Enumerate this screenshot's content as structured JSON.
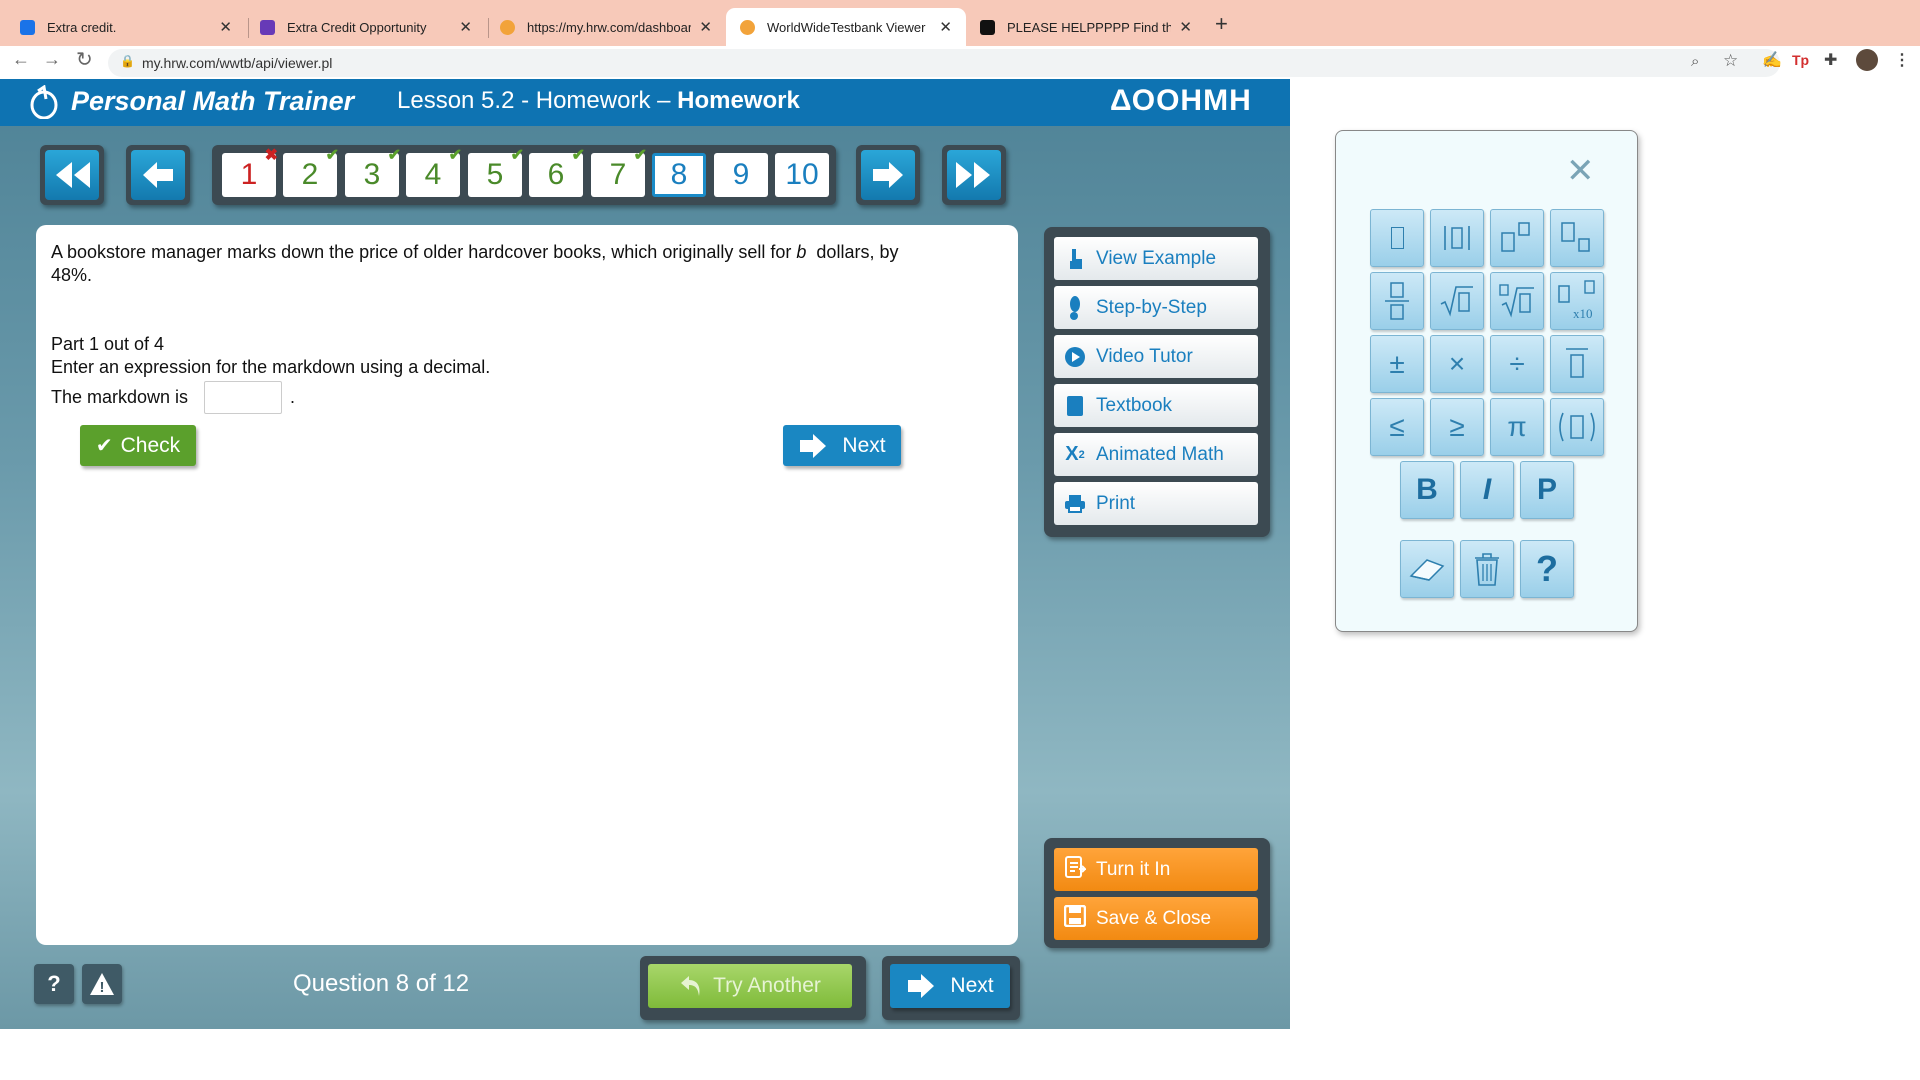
{
  "browser": {
    "tabs": [
      {
        "title": "Extra credit.",
        "favicon_color": "#1a73e8"
      },
      {
        "title": "Extra Credit Opportunity",
        "favicon_color": "#673ab7"
      },
      {
        "title": "https://my.hrw.com/dashboard",
        "favicon_color": "#f2a33a"
      },
      {
        "title": "WorldWideTestbank Viewer",
        "favicon_color": "#f2a33a",
        "active": true
      },
      {
        "title": "PLEASE HELPPPPP Find the sa",
        "favicon_color": "#111111"
      }
    ],
    "url": "my.hrw.com/wwtb/api/viewer.pl"
  },
  "header": {
    "brand": "Personal Math Trainer",
    "lesson_prefix": "Lesson 5.2 - Homework –",
    "lesson_suffix": "Homework",
    "publisher": "ΔΟΟHMH"
  },
  "questions": [
    {
      "num": "1",
      "status": "wrong"
    },
    {
      "num": "2",
      "status": "correct"
    },
    {
      "num": "3",
      "status": "correct"
    },
    {
      "num": "4",
      "status": "correct"
    },
    {
      "num": "5",
      "status": "correct"
    },
    {
      "num": "6",
      "status": "correct"
    },
    {
      "num": "7",
      "status": "correct"
    },
    {
      "num": "8",
      "status": "current"
    },
    {
      "num": "9",
      "status": "unanswered"
    },
    {
      "num": "10",
      "status": "unanswered"
    }
  ],
  "problem": {
    "text_a": "A bookstore manager marks down the price of older hardcover books, which originally sell for",
    "var": "b",
    "text_b": "dollars, by",
    "text_c": "48%.",
    "part": "Part 1 out of 4",
    "instruction": "Enter an expression for the markdown using a decimal.",
    "prompt": "The markdown is",
    "period": ".",
    "answer_value": ""
  },
  "buttons": {
    "check": "Check",
    "next": "Next",
    "try_another": "Try Another",
    "bottom_next": "Next"
  },
  "helpers": [
    {
      "label": "View Example",
      "icon": "pointing-hand-icon"
    },
    {
      "label": "Step-by-Step",
      "icon": "footprint-icon"
    },
    {
      "label": "Video Tutor",
      "icon": "play-icon"
    },
    {
      "label": "Textbook",
      "icon": "book-icon"
    },
    {
      "label": "Animated Math",
      "icon": "x-squared-icon"
    },
    {
      "label": "Print",
      "icon": "printer-icon"
    }
  ],
  "actions": [
    {
      "label": "Turn it In",
      "icon": "turn-in-icon"
    },
    {
      "label": "Save & Close",
      "icon": "floppy-icon"
    }
  ],
  "footer": {
    "question_count": "Question 8 of 12",
    "help": "?",
    "alert": "!"
  },
  "palette": {
    "close": "✕",
    "keys": {
      "plus_minus": "±",
      "times": "×",
      "divide": "÷",
      "le": "≤",
      "ge": "≥",
      "pi": "π",
      "bold": "B",
      "italic": "I",
      "p": "P",
      "help": "?",
      "x10": "x10"
    }
  },
  "colors": {
    "header_blue": "#0e73b2",
    "check_green": "#5ba02c",
    "next_blue": "#1a87c2",
    "orange": "#f28a12",
    "correct": "#4a8a2a",
    "wrong": "#cc2222"
  }
}
